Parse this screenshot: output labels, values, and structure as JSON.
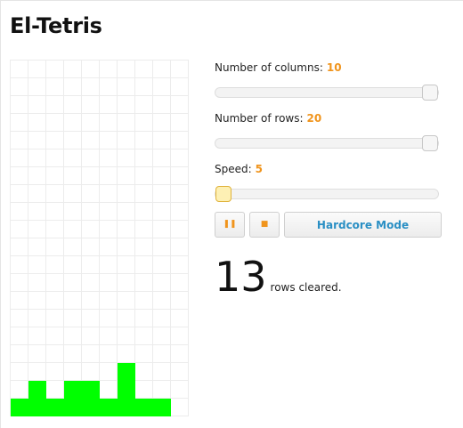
{
  "app": {
    "title": "El-Tetris"
  },
  "board": {
    "columns": 10,
    "rows": 20,
    "block_color": "#00ff00",
    "filled": [
      {
        "row": 17,
        "col": 6
      },
      {
        "row": 18,
        "col": 1
      },
      {
        "row": 18,
        "col": 3
      },
      {
        "row": 18,
        "col": 4
      },
      {
        "row": 18,
        "col": 6
      },
      {
        "row": 19,
        "col": 0
      },
      {
        "row": 19,
        "col": 1
      },
      {
        "row": 19,
        "col": 2
      },
      {
        "row": 19,
        "col": 3
      },
      {
        "row": 19,
        "col": 4
      },
      {
        "row": 19,
        "col": 5
      },
      {
        "row": 19,
        "col": 6
      },
      {
        "row": 19,
        "col": 7
      },
      {
        "row": 19,
        "col": 8
      }
    ]
  },
  "settings": {
    "columns": {
      "label": "Number of columns:",
      "value": "10",
      "level": 1.0
    },
    "rows": {
      "label": "Number of rows:",
      "value": "20",
      "level": 1.0
    },
    "speed": {
      "label": "Speed:",
      "value": "5",
      "level": 0.0
    }
  },
  "controls": {
    "pause_icon": "pause-icon",
    "pause_glyph": "❚❚",
    "stop_icon": "stop-icon",
    "stop_glyph": "■",
    "hardcore_label": "Hardcore Mode"
  },
  "score": {
    "count": "13",
    "label": "rows cleared."
  },
  "colors": {
    "accent": "#f0941c",
    "link": "#2a8fc4"
  }
}
